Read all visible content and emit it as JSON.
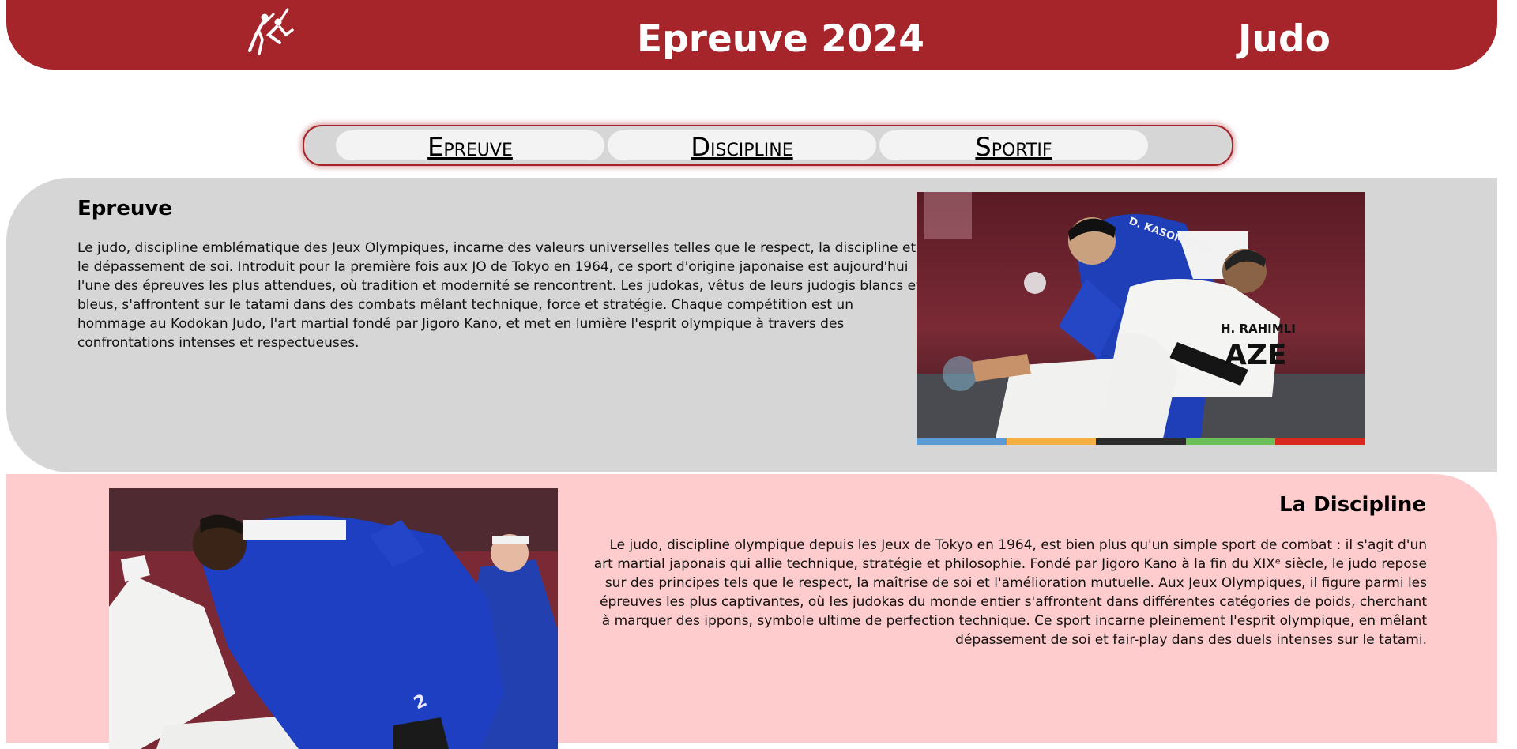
{
  "header": {
    "title": "Epreuve 2024",
    "sport": "Judo",
    "logo_icon": "judo-logo-icon",
    "bg_color": "#a5252b"
  },
  "nav": {
    "tabs": [
      {
        "label": "Epreuve"
      },
      {
        "label": "Discipline"
      },
      {
        "label": "Sportif"
      }
    ]
  },
  "epreuve": {
    "title": "Epreuve",
    "text": "Le judo, discipline emblématique des Jeux Olympiques, incarne des valeurs universelles telles que le respect, la discipline et le dépassement de soi. Introduit pour la première fois aux JO de Tokyo en 1964, ce sport d'origine japonaise est aujourd'hui l'une des épreuves les plus attendues, où tradition et modernité se rencontrent. Les judokas, vêtus de leurs judogis blancs et bleus, s'affrontent sur le tatami dans des combats mêlant technique, force et stratégie. Chaque compétition est un hommage au Kodokan Judo, l'art martial fondé par Jigoro Kano, et met en lumière l'esprit olympique à travers des confrontations intenses et respectueuses.",
    "image_back_name": "D. KASOMATOV",
    "image_front_name": "H. RAHIMLI",
    "image_country": "AZE",
    "stripe_colors": [
      "#5b9bd5",
      "#f5b041",
      "#2c2c2c",
      "#6bbf59",
      "#d9281e"
    ]
  },
  "discipline": {
    "title": "La Discipline",
    "text": "Le judo, discipline olympique depuis les Jeux de Tokyo en 1964, est bien plus qu'un simple sport de combat : il s'agit d'un art martial japonais qui allie technique, stratégie et philosophie. Fondé par Jigoro Kano à la fin du XIXᵉ siècle, le judo repose sur des principes tels que le respect, la maîtrise de soi et l'amélioration mutuelle. Aux Jeux Olympiques, il figure parmi les épreuves les plus captivantes, où les judokas du monde entier s'affrontent dans différentes catégories de poids, cherchant à marquer des ippons, symbole ultime de perfection technique. Ce sport incarne pleinement l'esprit olympique, en mêlant dépassement de soi et fair-play dans des duels intenses sur le tatami."
  }
}
